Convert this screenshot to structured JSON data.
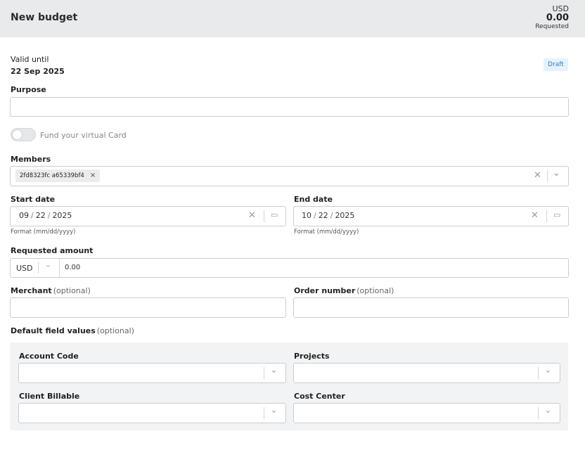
{
  "header": {
    "title": "New budget",
    "currency": "USD",
    "amount": "0.00",
    "amount_label": "Requested"
  },
  "validity": {
    "label": "Valid until",
    "date": "22 Sep 2025",
    "status": "Draft"
  },
  "purpose": {
    "label": "Purpose",
    "value": ""
  },
  "fund_toggle": {
    "label": "Fund your virtual Card",
    "on": false
  },
  "members": {
    "label": "Members",
    "chips": [
      "2fd8323fc a65339bf4"
    ]
  },
  "start_date": {
    "label": "Start date",
    "month": "09",
    "day": "22",
    "year": "2025",
    "hint": "Format (mm/dd/yyyy)"
  },
  "end_date": {
    "label": "End date",
    "month": "10",
    "day": "22",
    "year": "2025",
    "hint": "Format (mm/dd/yyyy)"
  },
  "requested_amount": {
    "label": "Requested amount",
    "currency": "USD",
    "value": "0.00"
  },
  "merchant": {
    "label": "Merchant",
    "optional": "(optional)",
    "value": ""
  },
  "order_number": {
    "label": "Order number",
    "optional": "(optional)",
    "value": ""
  },
  "defaults": {
    "label": "Default field values",
    "optional": "(optional)",
    "fields": {
      "account_code": "Account Code",
      "projects": "Projects",
      "client_billable": "Client Billable",
      "cost_center": "Cost Center"
    }
  },
  "icons": {
    "clear": "clear-icon",
    "chevron": "chevron-down-icon",
    "calendar": "calendar-icon",
    "remove": "remove-chip-icon"
  }
}
